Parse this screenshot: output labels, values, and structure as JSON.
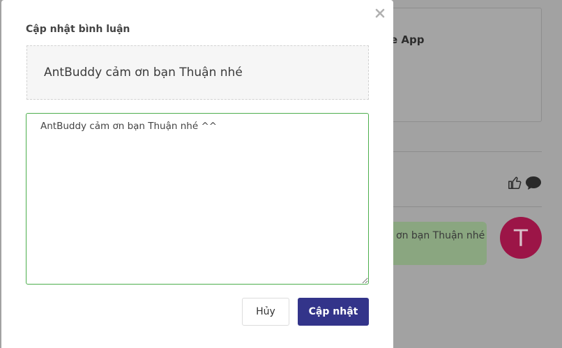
{
  "background": {
    "card_text": "e App",
    "comment_bubble_text": "ơn bạn Thuận nhé",
    "avatar_letter": "T",
    "avatar_color": "#c2185b"
  },
  "modal": {
    "title": "Cập nhật bình luận",
    "original_comment": "AntBuddy cảm ơn bạn Thuận nhé",
    "edit_value": "AntBuddy cảm ơn bạn Thuận nhé ^^",
    "cancel_label": "Hủy",
    "update_label": "Cập nhật",
    "close_icon": "close-icon",
    "accent_color": "#33348a",
    "focus_border_color": "#4cae4c"
  }
}
